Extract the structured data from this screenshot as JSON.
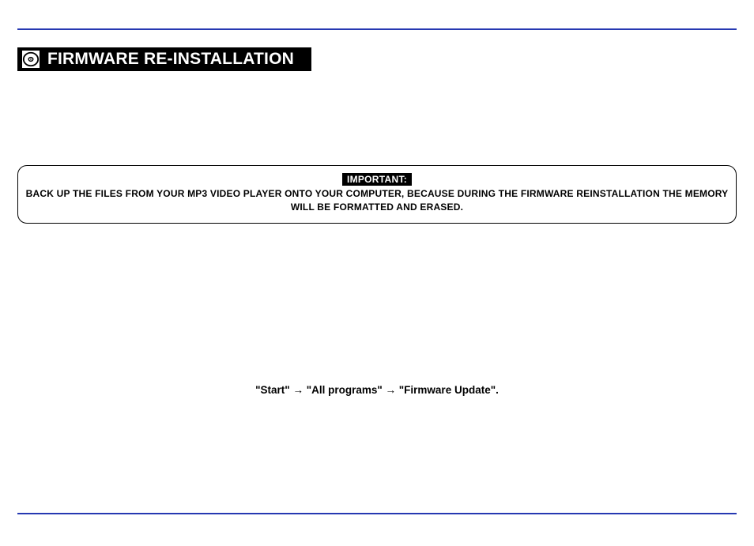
{
  "page": {
    "header_icon": "disc-icon",
    "title": "FIRMWARE RE-INSTALLATION",
    "important_label": "IMPORTANT:",
    "notice_text": "BACK UP THE FILES FROM YOUR MP3 VIDEO PLAYER ONTO YOUR COMPUTER, BECAUSE DURING THE FIRMWARE REINSTALLATION THE MEMORY WILL BE FORMATTED AND ERASED.",
    "path_hint": "\"Start\" → \"All programs\" → \"Firmware Update\"."
  }
}
